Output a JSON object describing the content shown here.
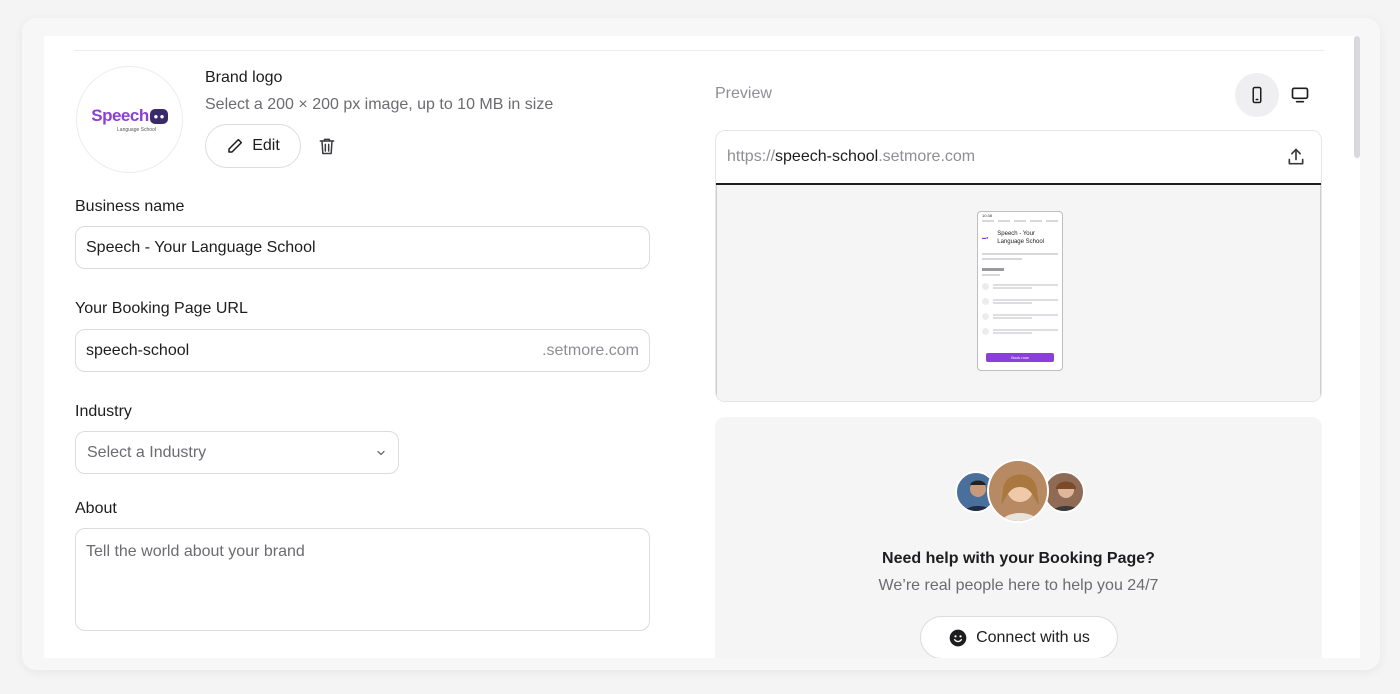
{
  "brand": {
    "title": "Brand logo",
    "subtitle": "Select a 200 × 200 px image, up to 10 MB in size",
    "edit_label": "Edit",
    "logo_text": "Speech",
    "logo_subtext": "Language School"
  },
  "business_name": {
    "label": "Business name",
    "value": "Speech - Your Language School"
  },
  "booking_url": {
    "label": "Your Booking Page URL",
    "value": "speech-school",
    "suffix": ".setmore.com"
  },
  "industry": {
    "label": "Industry",
    "placeholder": "Select a Industry"
  },
  "about": {
    "label": "About",
    "placeholder": "Tell the world about your brand"
  },
  "preview": {
    "label": "Preview",
    "url_protocol": "https://",
    "url_slug": "speech-school",
    "url_domain": ".setmore.com",
    "phone": {
      "time": "10:38",
      "business_name": "Speech - Your Language School",
      "book_label": "Book now"
    }
  },
  "help": {
    "title": "Need help with your Booking Page?",
    "subtitle": "We’re real people here to help you 24/7",
    "connect_label": "Connect with us"
  },
  "colors": {
    "accent": "#8b3fd9",
    "border": "#dcdce0",
    "muted": "#6b6b70"
  }
}
